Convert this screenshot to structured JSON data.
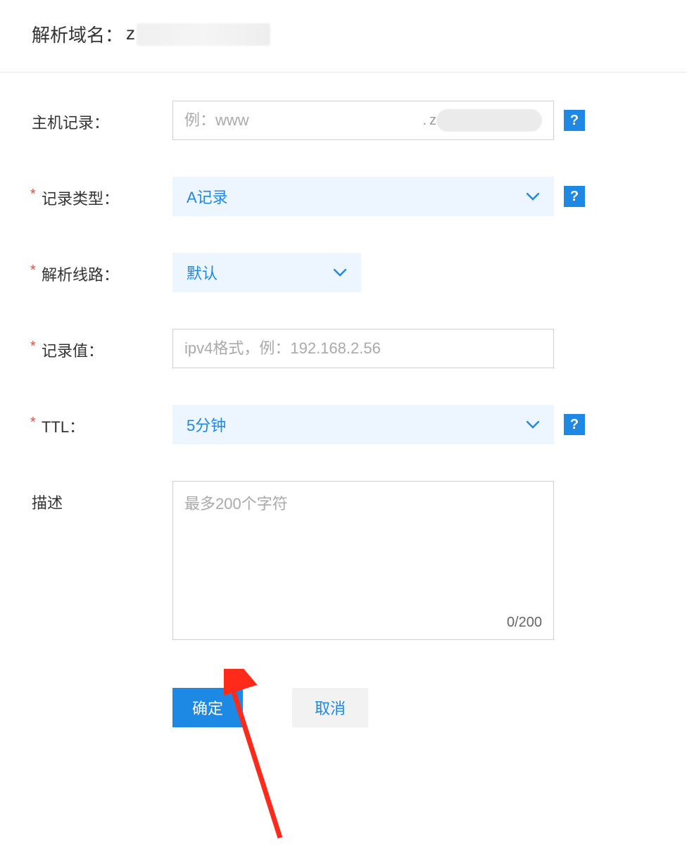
{
  "header": {
    "title_prefix": "解析域名：",
    "domain_visible_char": "z"
  },
  "form": {
    "host_record": {
      "label": "主机记录：",
      "placeholder": "例：www",
      "suffix_visible_char": "z"
    },
    "record_type": {
      "label": "记录类型：",
      "value": "A记录"
    },
    "resolution_line": {
      "label": "解析线路：",
      "value": "默认"
    },
    "record_value": {
      "label": "记录值：",
      "placeholder": "ipv4格式，例：192.168.2.56"
    },
    "ttl": {
      "label": "TTL：",
      "value": "5分钟"
    },
    "description": {
      "label": "描述",
      "placeholder": "最多200个字符",
      "char_count": "0/200"
    }
  },
  "buttons": {
    "confirm": "确定",
    "cancel": "取消"
  },
  "help_icon_char": "?"
}
